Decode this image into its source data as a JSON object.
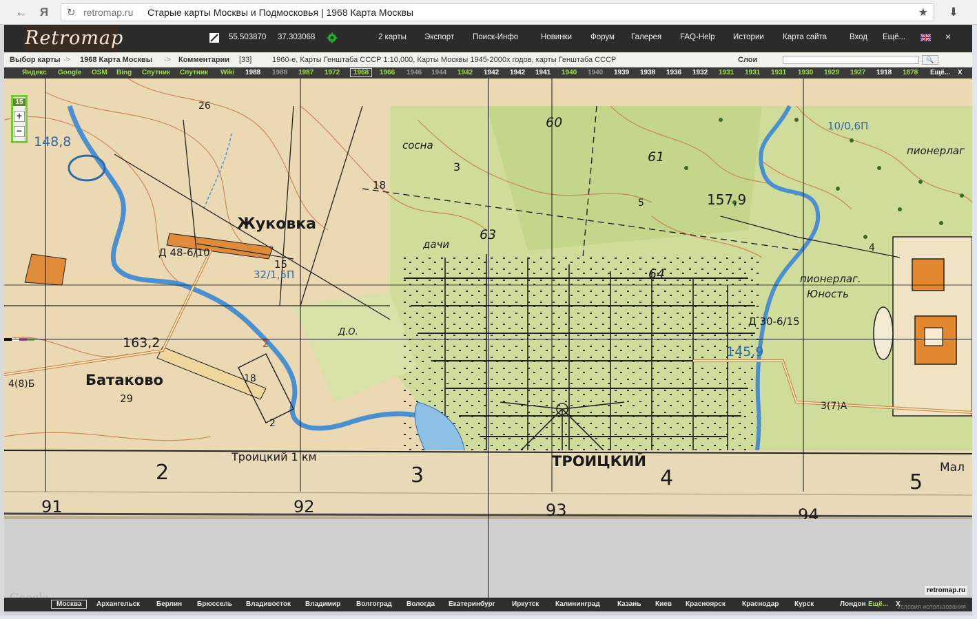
{
  "browser": {
    "back_glyph": "←",
    "yandex_glyph": "Я",
    "reload_glyph": "↻",
    "host": "retromap.ru",
    "title": "Старые карты Москвы и Подмосковья | 1968 Карта Москвы",
    "star_glyph": "★",
    "download_glyph": "⬇"
  },
  "site": {
    "logo": "Retromap",
    "coord_lat": "55.503870",
    "coord_lon": "37.303068",
    "nav": [
      "2 карты",
      "Экспорт",
      "Поиск-Инфо",
      "Новинки",
      "Форум",
      "Галерея",
      "FAQ-Help",
      "Истории",
      "Карта сайта",
      "Вход",
      "Ещё..."
    ],
    "close_glyph": "×",
    "breadcrumb": {
      "choose_map": "Выбор карты",
      "sep1": " -> ",
      "map_name": "1968 Карта Москвы",
      "sep2": " -> ",
      "comments": "Комментарии",
      "comments_count": "[33]",
      "description": "1960-е, Карты Генштаба СССР 1:10,000, Карты Москвы 1945-2000х годов, карты Генштаба СССР",
      "layers": "Слои"
    },
    "layer_search_btn": "🔍"
  },
  "yearbar": {
    "items": [
      {
        "t": "Яндекс",
        "c": "g"
      },
      {
        "t": "Google",
        "c": "g"
      },
      {
        "t": "OSM",
        "c": "g"
      },
      {
        "t": "Bing",
        "c": "g"
      },
      {
        "t": "Спутник",
        "c": "g"
      },
      {
        "t": "Спутник",
        "c": "g"
      },
      {
        "t": "Wiki",
        "c": "g"
      },
      {
        "t": "1988",
        "c": "w"
      },
      {
        "t": "1988",
        "c": "d"
      },
      {
        "t": "1987",
        "c": "g"
      },
      {
        "t": "1972",
        "c": "g"
      },
      {
        "t": "1968",
        "c": "sel"
      },
      {
        "t": "1966",
        "c": "g"
      },
      {
        "t": "1946",
        "c": "d"
      },
      {
        "t": "1944",
        "c": "d"
      },
      {
        "t": "1942",
        "c": "g"
      },
      {
        "t": "1942",
        "c": "w"
      },
      {
        "t": "1942",
        "c": "w"
      },
      {
        "t": "1941",
        "c": "w"
      },
      {
        "t": "1940",
        "c": "g"
      },
      {
        "t": "1940",
        "c": "d"
      },
      {
        "t": "1939",
        "c": "w"
      },
      {
        "t": "1938",
        "c": "w"
      },
      {
        "t": "1936",
        "c": "w"
      },
      {
        "t": "1932",
        "c": "w"
      },
      {
        "t": "1931",
        "c": "g"
      },
      {
        "t": "1931",
        "c": "g"
      },
      {
        "t": "1931",
        "c": "g"
      },
      {
        "t": "1930",
        "c": "g"
      },
      {
        "t": "1929",
        "c": "g"
      },
      {
        "t": "1927",
        "c": "g"
      },
      {
        "t": "1918",
        "c": "w"
      },
      {
        "t": "1878",
        "c": "g"
      },
      {
        "t": "Ещё...",
        "c": "w"
      }
    ],
    "close": "X"
  },
  "map": {
    "zoom_level": "15",
    "zoom_in": "+",
    "zoom_out": "−",
    "labels": {
      "zhukovka": "Жуковка",
      "batakovo": "Батаково",
      "troitsky": "ТРОИЦКИЙ",
      "troitsky_km": "Троицкий 1 км",
      "dachi": "дачи",
      "sosna": "сосна",
      "pionerlag": "пионерлаг.",
      "yunost": "Юность",
      "pionerlag2": "пионерлаг",
      "do": "Д.О.",
      "mal": "Мал"
    },
    "elevations": [
      "148,8",
      "163,2",
      "157,9",
      "145,9"
    ],
    "bridges": [
      "Д 48-6/10",
      "Д 30-6/15",
      "32/1,5П",
      "10/0,6П"
    ],
    "roads": [
      "4(8)Б",
      "3(7)А",
      "5",
      "4"
    ],
    "numbers": [
      "18",
      "15",
      "29",
      "60",
      "61",
      "63",
      "64",
      "3",
      "2",
      "26",
      "18",
      "2"
    ],
    "grid_x": [
      "91",
      "92",
      "93",
      "94"
    ],
    "grid_y": [
      "2",
      "3",
      "4",
      "5"
    ]
  },
  "footer": {
    "cities": [
      "Москва",
      "Архангельск",
      "Берлин",
      "Брюссель",
      "Владивосток",
      "Владимир",
      "Волгоград",
      "Вологда",
      "Екатеринбург",
      "Иркутск",
      "Калининград",
      "Казань",
      "Киев",
      "Красноярск",
      "Краснодар",
      "Курск",
      "Лондон"
    ],
    "more": "Ещё...",
    "close": "X",
    "google": "Google",
    "sitemark": "retromap.ru",
    "terms": "Условия использования"
  }
}
